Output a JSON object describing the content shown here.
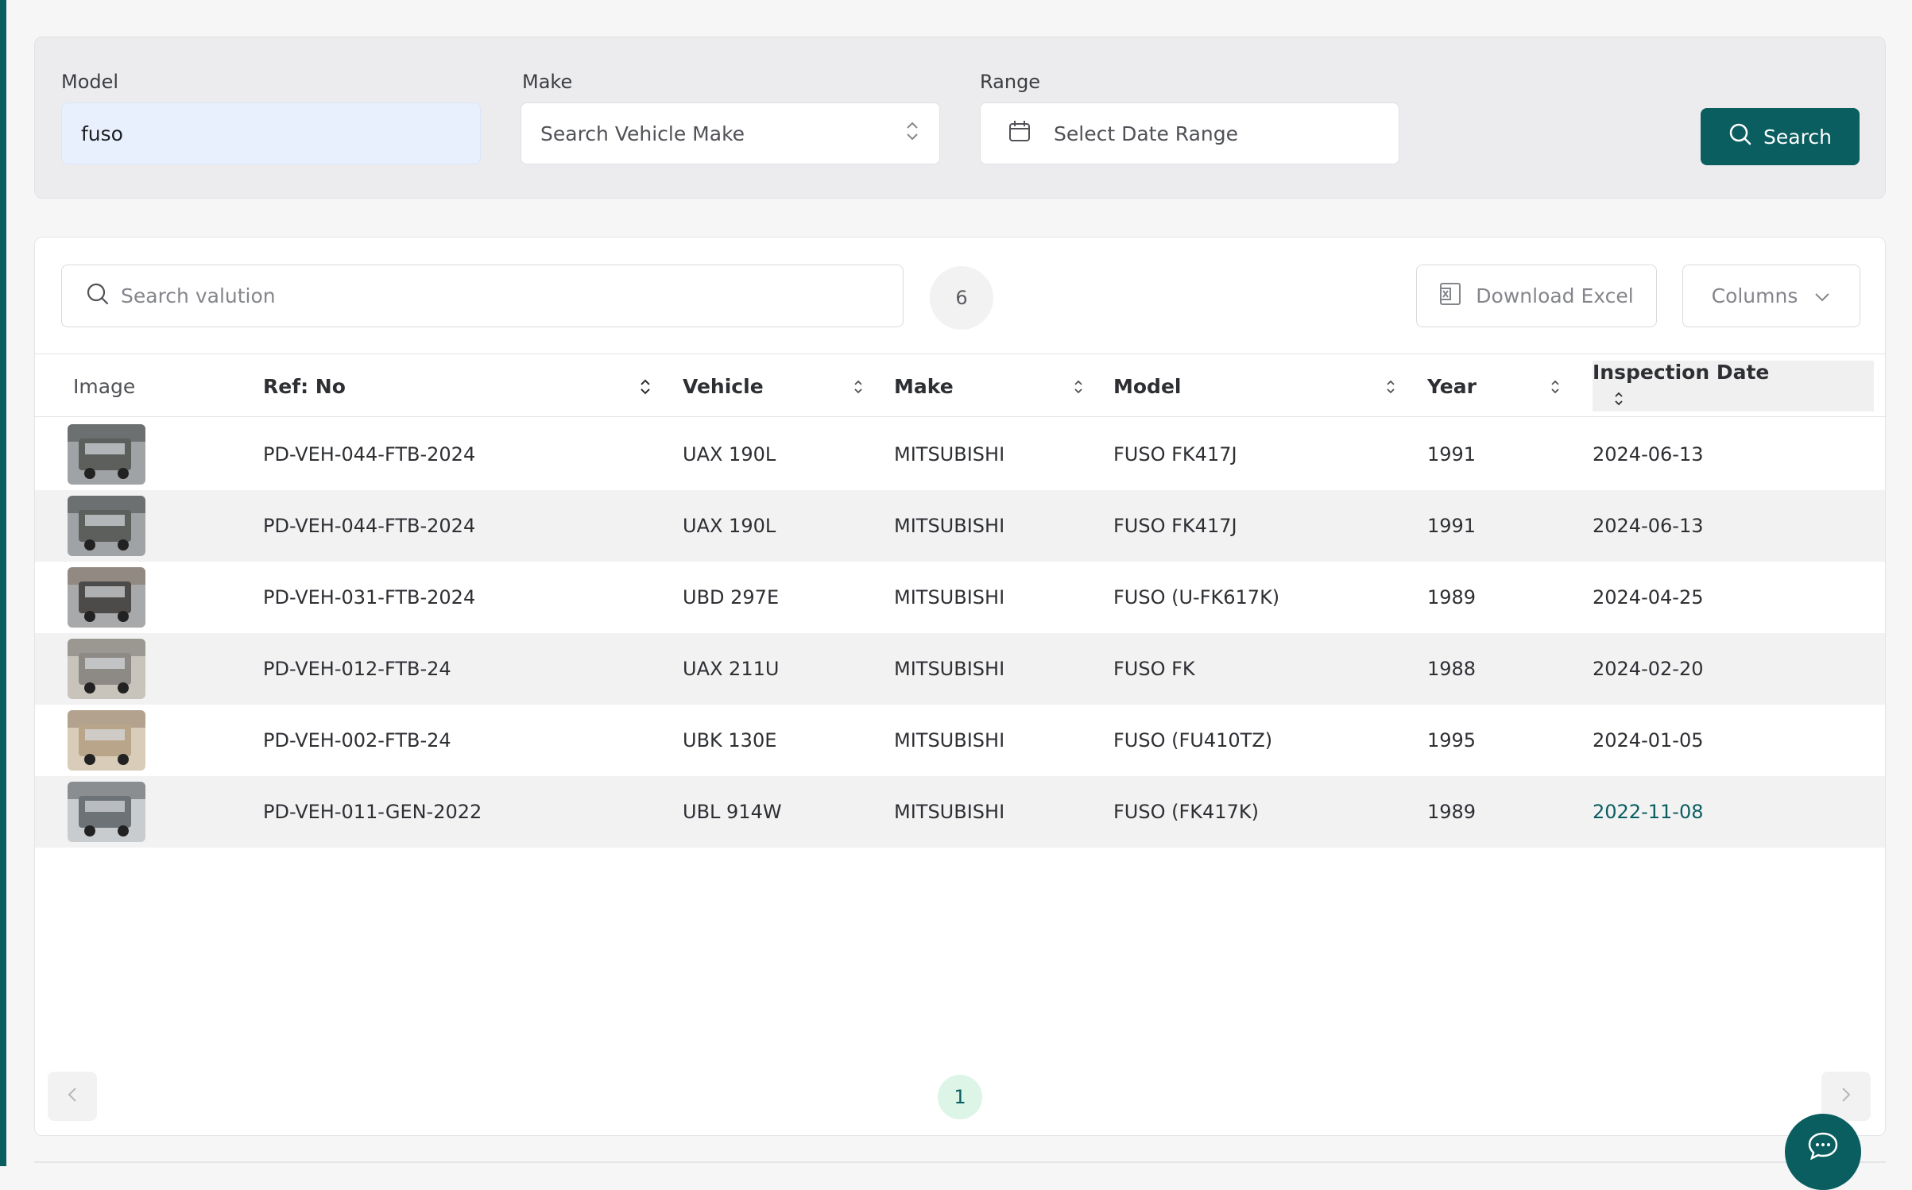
{
  "filters": {
    "model_label": "Model",
    "model_value": "fuso",
    "make_label": "Make",
    "make_placeholder": "Search Vehicle Make",
    "range_label": "Range",
    "range_placeholder": "Select Date Range",
    "search_button": "Search"
  },
  "toolbar": {
    "search_placeholder": "Search valution",
    "result_count": "6",
    "download_label": "Download Excel",
    "columns_label": "Columns"
  },
  "table": {
    "headers": {
      "image": "Image",
      "ref": "Ref: No",
      "vehicle": "Vehicle",
      "make": "Make",
      "model": "Model",
      "year": "Year",
      "date": "Inspection Date"
    },
    "rows": [
      {
        "ref": "PD-VEH-044-FTB-2024",
        "vehicle": "UAX 190L",
        "make": "MITSUBISHI",
        "model": "FUSO FK417J",
        "year": "1991",
        "date": "2024-06-13"
      },
      {
        "ref": "PD-VEH-044-FTB-2024",
        "vehicle": "UAX 190L",
        "make": "MITSUBISHI",
        "model": "FUSO FK417J",
        "year": "1991",
        "date": "2024-06-13"
      },
      {
        "ref": "PD-VEH-031-FTB-2024",
        "vehicle": "UBD 297E",
        "make": "MITSUBISHI",
        "model": "FUSO (U-FK617K)",
        "year": "1989",
        "date": "2024-04-25"
      },
      {
        "ref": "PD-VEH-012-FTB-24",
        "vehicle": "UAX 211U",
        "make": "MITSUBISHI",
        "model": "FUSO FK",
        "year": "1988",
        "date": "2024-02-20"
      },
      {
        "ref": "PD-VEH-002-FTB-24",
        "vehicle": "UBK 130E",
        "make": "MITSUBISHI",
        "model": "FUSO (FU410TZ)",
        "year": "1995",
        "date": "2024-01-05"
      },
      {
        "ref": "PD-VEH-011-GEN-2022",
        "vehicle": "UBL 914W",
        "make": "MITSUBISHI",
        "model": "FUSO (FK417K)",
        "year": "1989",
        "date": "2022-11-08"
      }
    ]
  },
  "pagination": {
    "current_page": "1"
  },
  "colors": {
    "accent": "#0b5e60",
    "highlight_date": "#0b5e60"
  }
}
